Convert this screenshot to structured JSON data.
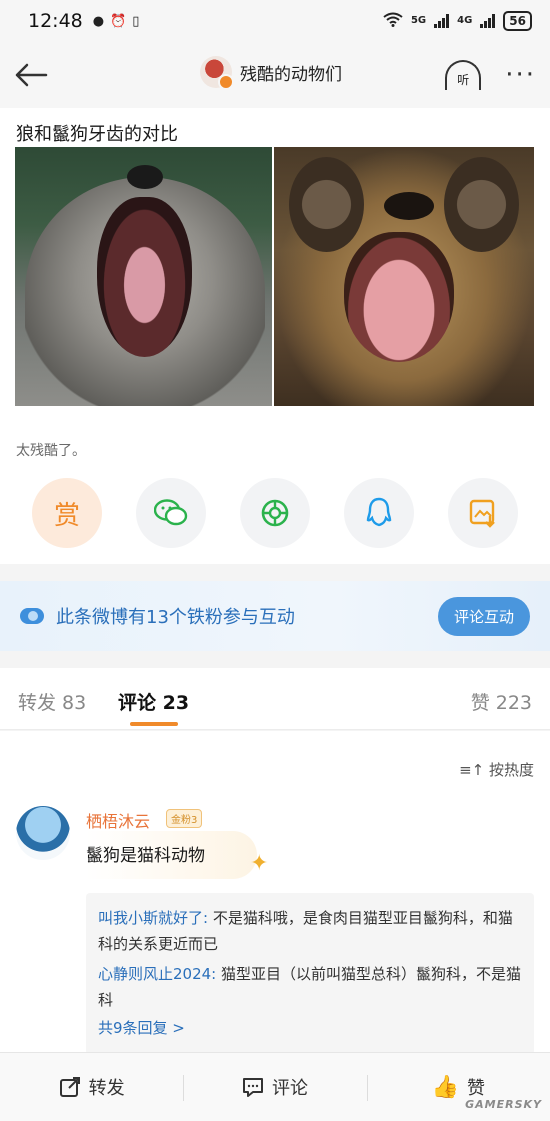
{
  "status_bar": {
    "time": "12:48",
    "battery": "56",
    "net1": "5G",
    "net2": "4G"
  },
  "nav": {
    "title": "残酷的动物们",
    "listen_label": "听"
  },
  "post": {
    "text": "狼和鬣狗牙齿的对比",
    "caption": "太残酷了。",
    "share": {
      "reward_label": "赏"
    }
  },
  "banner": {
    "text": "此条微博有13个铁粉参与互动",
    "button": "评论互动"
  },
  "tabs": {
    "repost": "转发 83",
    "comment": "评论 23",
    "like": "赞 223"
  },
  "comments": {
    "sort_label": "按热度",
    "items": [
      {
        "name": "栖梧沐云",
        "badge": "金粉3",
        "text": "鬣狗是猫科动物",
        "replies": [
          {
            "name": "叫我小斯就好了:",
            "text": " 不是猫科哦，是食肉目猫型亚目鬣狗科，和猫科的关系更近而已"
          },
          {
            "name": "心静则风止2024:",
            "text": " 猫型亚目（以前叫猫型总科）鬣狗科，不是猫科"
          }
        ],
        "more": "共9条回复 >"
      }
    ]
  },
  "bottom_bar": {
    "repost": "转发",
    "comment": "评论",
    "like": "赞"
  },
  "watermark": "GAMERSKY",
  "colors": {
    "accent_orange": "#f08a2a",
    "link_blue": "#2a6fba",
    "banner_button": "#4a96dd"
  }
}
